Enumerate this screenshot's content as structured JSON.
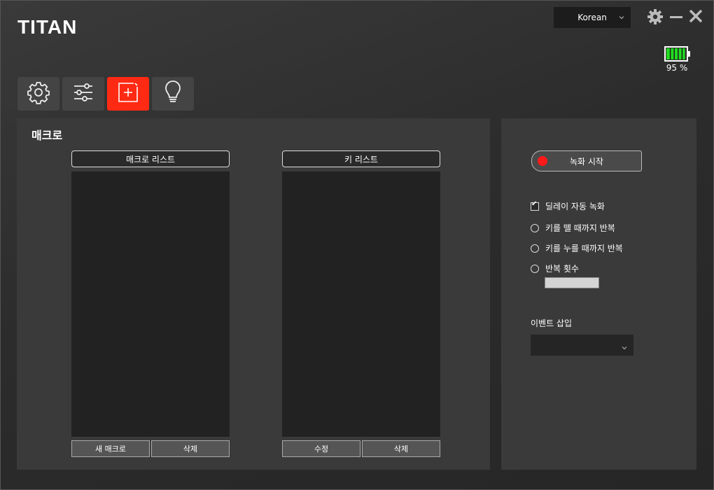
{
  "app": {
    "logo": "TITAN"
  },
  "language": {
    "selected": "Korean"
  },
  "battery": {
    "level_percent": 95,
    "label": "95 %"
  },
  "nav": [
    {
      "icon": "gear-icon"
    },
    {
      "icon": "sliders-icon"
    },
    {
      "icon": "macro-add-icon",
      "active": true
    },
    {
      "icon": "lightbulb-icon"
    }
  ],
  "macro_panel": {
    "title": "매크로",
    "macro_list_header": "매크로 리스트",
    "key_list_header": "키 리스트",
    "new_macro_button": "새 매크로",
    "delete_macro_button": "삭제",
    "edit_key_button": "수정",
    "delete_key_button": "삭제"
  },
  "record_panel": {
    "record_button": "녹화 시작",
    "delay_auto_record": "딜레이 자동 녹화",
    "delay_checked": true,
    "repeat_until_release": "키를 뗄 때까지 반복",
    "repeat_until_press": "키를 누를 때까지 반복",
    "repeat_count": "반복 횟수",
    "event_insert_label": "이벤트 삽입"
  },
  "colors": {
    "accent": "#ff2a13",
    "record_dot": "#ff1a1a",
    "battery_fill": "#22dd22"
  }
}
